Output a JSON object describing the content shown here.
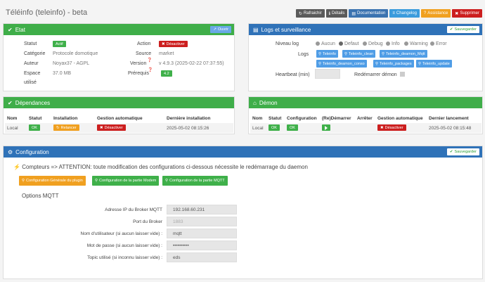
{
  "page": {
    "title": "Téléinfo (teleinfo) - beta"
  },
  "topbar": {
    "refresh": "Rafraichir",
    "details": "Détails",
    "documentation": "Documentation",
    "changelog": "Changelog",
    "assistance": "Assistance",
    "delete": "Supprimer"
  },
  "etat": {
    "header": "Etat",
    "open_btn": "Ouvrir",
    "statut_label": "Statut",
    "statut_value": "Actif",
    "action_label": "Action",
    "action_btn": "Désactiver",
    "categorie_label": "Catégorie",
    "categorie_value": "Protocole domotique",
    "source_label": "Source",
    "source_value": "market",
    "auteur_label": "Auteur",
    "auteur_value": "Noyax37 - AGPL",
    "version_label": "Version",
    "version_value": "v 4.9.3 (2025-02-22 07:37:55)",
    "espace_label": "Espace",
    "espace_label2": "utilisé",
    "espace_value": "37.0 MB",
    "prerequis_label": "Prérequis",
    "prerequis_value": "4.2"
  },
  "logs": {
    "header": "Logs et surveillance",
    "save_btn": "Sauvegarder",
    "niveau_label": "Niveau log",
    "levels": [
      "Aucun",
      "Defaut",
      "Debug",
      "Info",
      "Warning",
      "Error"
    ],
    "logs_label": "Logs",
    "files": [
      "Teleinfo",
      "Teleinfo_clean",
      "Teleinfo_deamon_Mqtt",
      "Teleinfo_deamon_conso",
      "Teleinfo_packages",
      "Teleinfo_update"
    ],
    "heartbeat_label": "Heartbeat (min)",
    "restart_label": "Redémarrer démon"
  },
  "deps": {
    "header": "Dépendances",
    "columns": [
      "Nom",
      "Statut",
      "Installation",
      "Gestion automatique",
      "Dernière installation"
    ],
    "row": {
      "nom": "Local",
      "statut": "OK",
      "install": "Relancer",
      "gestion": "Désactiver",
      "last": "2025-05-02 08:15:26"
    }
  },
  "daemon": {
    "header": "Démon",
    "columns": [
      "Nom",
      "Statut",
      "Configuration",
      "(Re)Démarrer",
      "Arrêter",
      "Gestion automatique",
      "Dernier lancement"
    ],
    "row": {
      "nom": "Local",
      "statut": "OK",
      "config": "OK",
      "gestion": "Désactiver",
      "last": "2025-05-02 08:15:48"
    }
  },
  "config": {
    "header": "Configuration",
    "save_btn": "Sauvegarder",
    "warning": "Compteurs => ATTENTION: toute modification des configurations ci-dessous nécessite le redémarrage du daemon",
    "tabs": [
      "Configuration Générale du plugin",
      "Configuration de la partie Modem",
      "Configuration de la partie MQTT"
    ],
    "section": "Options MQTT",
    "fields": [
      {
        "label": "Adresse IP du Broker MQTT",
        "value": "192.168.60.231"
      },
      {
        "label": "Port du Broker",
        "value": "1883"
      },
      {
        "label": "Nom d'utilisateur (si aucun laisser vide) :",
        "value": "mqtt"
      },
      {
        "label": "Mot de passe (si aucun laisser vide) :",
        "value": "••••••••••"
      },
      {
        "label": "Topic utilisé (si inconnu laisser vide) :",
        "value": "eds"
      }
    ]
  },
  "colors": {
    "green": "#3fae49",
    "blue": "#2f72b8",
    "red": "#cc1f1f",
    "orange": "#f0a020"
  }
}
